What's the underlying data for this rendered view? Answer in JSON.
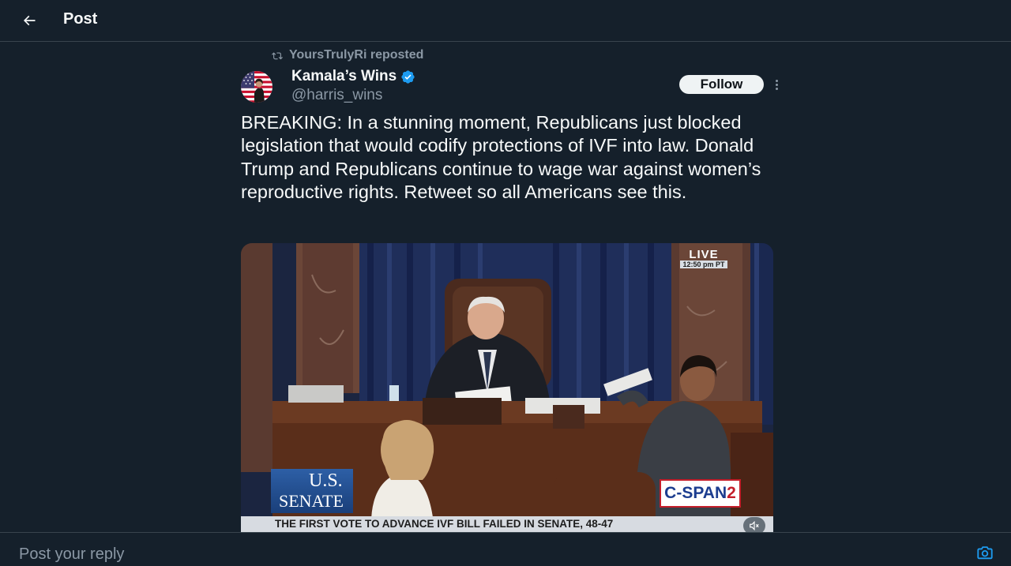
{
  "header": {
    "title": "Post"
  },
  "post": {
    "repost_by": "YoursTrulyRi reposted",
    "author_name": "Kamala’s Wins",
    "author_handle": "@harris_wins",
    "verified": true,
    "follow_label": "Follow",
    "text": "BREAKING: In a stunning moment, Republicans just blocked legislation that would codify protections of IVF into law. Donald Trump and Republicans continue to wage war against women’s reproductive rights. Retweet so all Americans see this."
  },
  "video": {
    "live_label": "LIVE",
    "live_time": "12:50 pm PT",
    "senate_logo_line1": "U.S.",
    "senate_logo_line2": "SENATE",
    "network_part1": "C-SPAN",
    "network_part2": "2",
    "ticker": "THE FIRST VOTE TO ADVANCE IVF BILL FAILED IN SENATE, 48-47",
    "muted": true
  },
  "reply": {
    "placeholder": "Post your reply"
  },
  "colors": {
    "background": "#15202b",
    "border": "#38444d",
    "secondary_text": "#8b98a5",
    "accent": "#1d9bf0",
    "verified_badge": "#1d9bf0"
  }
}
